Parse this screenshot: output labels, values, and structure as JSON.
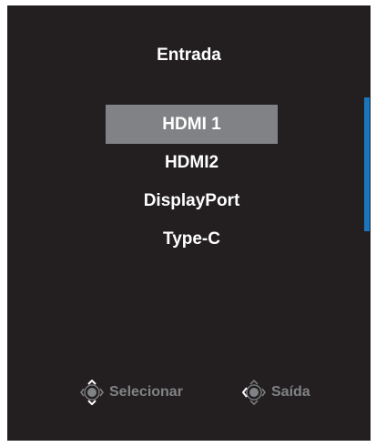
{
  "menu": {
    "title": "Entrada",
    "items": [
      {
        "label": "HDMI 1",
        "selected": true
      },
      {
        "label": "HDMI2",
        "selected": false
      },
      {
        "label": "DisplayPort",
        "selected": false
      },
      {
        "label": "Type-C",
        "selected": false
      }
    ]
  },
  "footer": {
    "select_label": "Selecionar",
    "select_icon": "joystick-updown-icon",
    "exit_label": "Saída",
    "exit_icon": "joystick-left-icon"
  },
  "colors": {
    "background": "#231f20",
    "text": "#ffffff",
    "selected_bg": "#808285",
    "hint_text": "#808285",
    "scrollbar": "#1b75bb"
  }
}
